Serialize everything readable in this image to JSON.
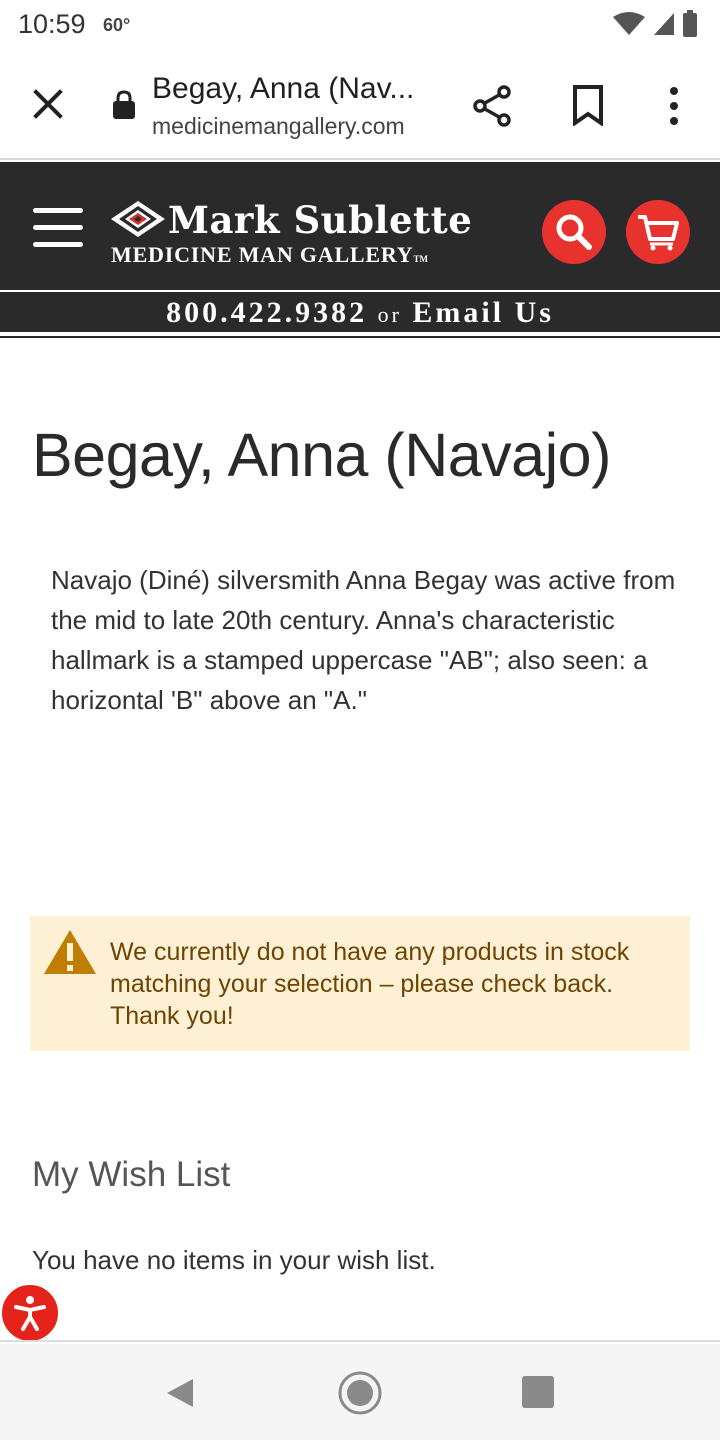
{
  "status_bar": {
    "time": "10:59",
    "temperature": "60°"
  },
  "browser": {
    "tab_title": "Begay, Anna (Nav...",
    "url": "medicinemangallery.com",
    "icons": [
      "close-icon",
      "lock-icon",
      "share-icon",
      "bookmark-icon",
      "more-vert-icon"
    ]
  },
  "site_header": {
    "logo_line1": "Mark Sublette",
    "logo_line2": "MEDICINE MAN GALLERY",
    "logo_tm": "TM",
    "phone": "800.422.9382",
    "or_text": "or",
    "email_link": "Email Us",
    "colors": {
      "header_bg": "#2a2a2a",
      "accent_red": "#e8322d"
    }
  },
  "page": {
    "title": "Begay, Anna (Navajo)",
    "description": "Navajo (Diné) silversmith Anna Begay was active from the mid to late 20th century. Anna's characteristic hallmark is a stamped uppercase \"AB\"; also seen: a horizontal 'B\" above an \"A.\""
  },
  "notice": {
    "text": "We currently do not have any products in stock matching your selection – please check back. Thank you!",
    "colors": {
      "bg": "#fdf0d5",
      "text": "#6f4400",
      "icon": "#c07d00"
    }
  },
  "wishlist": {
    "title": "My Wish List",
    "empty_text": "You have no items in your wish list."
  }
}
